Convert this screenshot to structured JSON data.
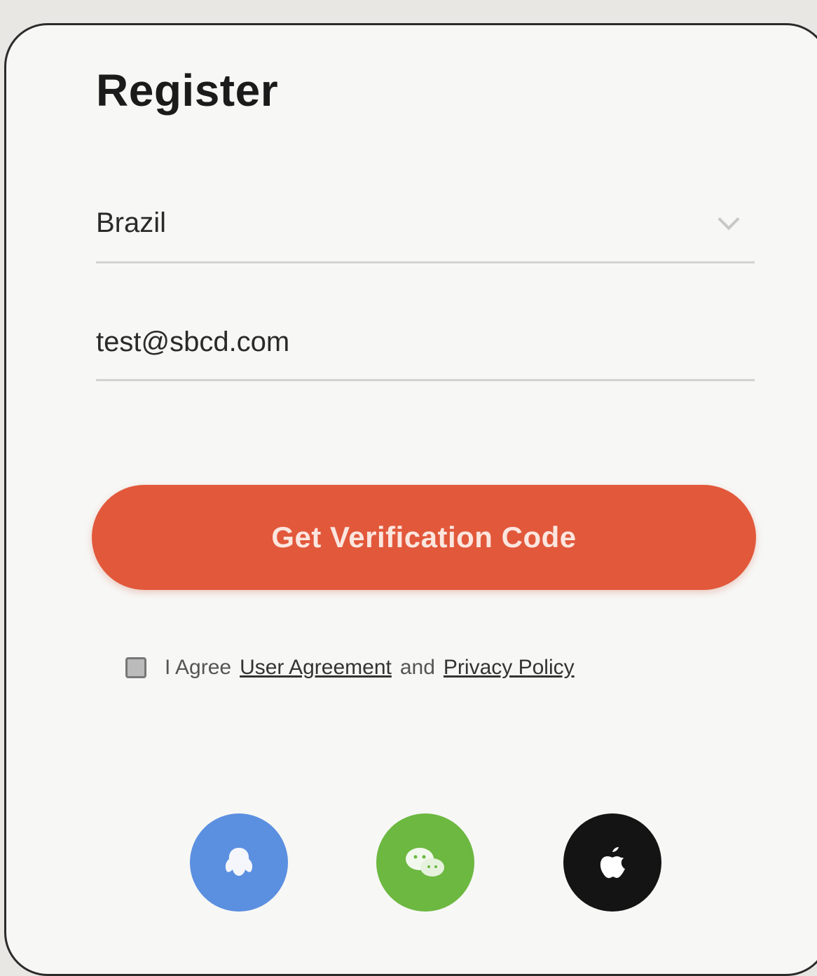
{
  "title": "Register",
  "country_field": {
    "value": "Brazil",
    "icon": "chevron-down-icon"
  },
  "email_field": {
    "value": "test@sbcd.com"
  },
  "cta_button": {
    "label": "Get Verification Code",
    "color": "#e2583b"
  },
  "agreement": {
    "prefix": "I Agree",
    "user_agreement": "User Agreement",
    "conjunction": "and",
    "privacy_policy": "Privacy Policy"
  },
  "social_login": [
    {
      "name": "google-icon",
      "color": "#5b8fe0"
    },
    {
      "name": "wechat-icon",
      "color": "#6cb840"
    },
    {
      "name": "apple-icon",
      "color": "#141414"
    }
  ]
}
